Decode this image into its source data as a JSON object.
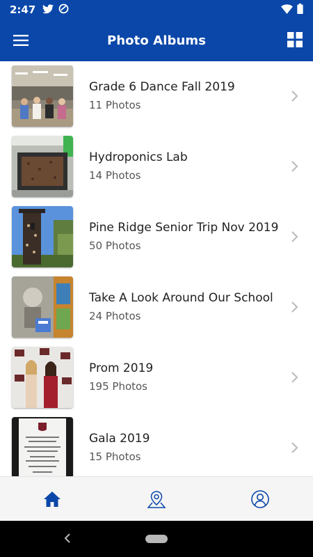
{
  "status_bar": {
    "time": "2:47",
    "icons_left": [
      "twitter-icon",
      "sync-icon"
    ],
    "icons_right": [
      "wifi-icon",
      "battery-icon"
    ]
  },
  "app_bar": {
    "title": "Photo Albums",
    "left_icon": "menu-icon",
    "right_icon": "grid-icon"
  },
  "albums": [
    {
      "title": "Grade 6 Dance Fall 2019",
      "count": "11 Photos"
    },
    {
      "title": "Hydroponics Lab",
      "count": "14 Photos"
    },
    {
      "title": "Pine Ridge Senior Trip Nov 2019",
      "count": "50 Photos"
    },
    {
      "title": "Take A Look Around Our School",
      "count": "24 Photos"
    },
    {
      "title": "Prom 2019",
      "count": "195 Photos"
    },
    {
      "title": "Gala 2019",
      "count": "15 Photos"
    }
  ],
  "bottom_nav": {
    "items": [
      "home-icon",
      "map-pin-icon",
      "profile-icon"
    ],
    "active": "home-icon"
  },
  "colors": {
    "primary": "#0a47a9",
    "nav_background": "#f5f5f5",
    "title_text": "#212121",
    "subtitle_text": "#555555"
  }
}
